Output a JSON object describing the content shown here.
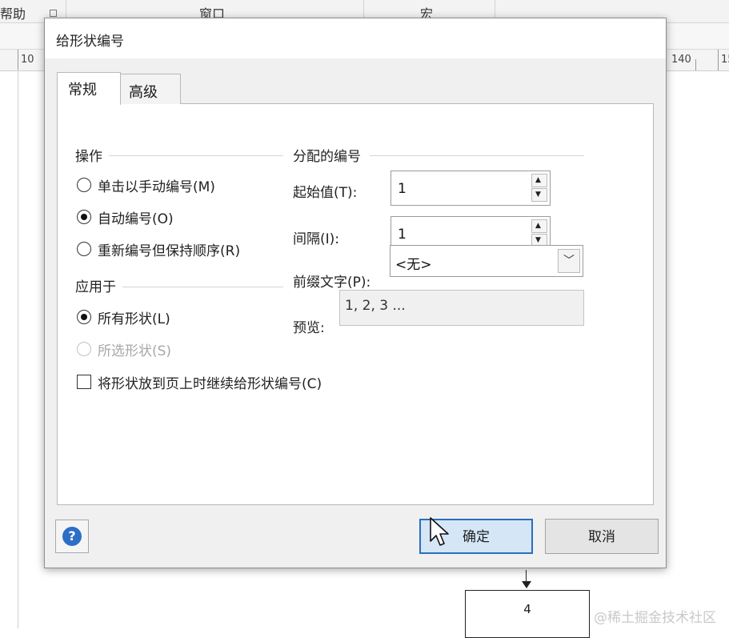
{
  "app": {
    "menubar": {
      "help": "帮助",
      "window": "窗口",
      "macro": "宏"
    },
    "ruler_labels": [
      "10",
      "140",
      "15"
    ],
    "canvas_shape_label": "4",
    "watermark": "@稀土掘金技术社区"
  },
  "dialog": {
    "title": "给形状编号",
    "tabs": [
      {
        "label": "常规",
        "active": true
      },
      {
        "label": "高级",
        "active": false
      }
    ],
    "operation": {
      "title": "操作",
      "options": [
        {
          "label": "单击以手动编号(M)",
          "selected": false
        },
        {
          "label": "自动编号(O)",
          "selected": true
        },
        {
          "label": "重新编号但保持顺序(R)",
          "selected": false
        }
      ]
    },
    "apply_to": {
      "title": "应用于",
      "options": [
        {
          "label": "所有形状(L)",
          "selected": true,
          "enabled": true
        },
        {
          "label": "所选形状(S)",
          "selected": false,
          "enabled": false
        }
      ]
    },
    "continue_checkbox": {
      "label": "将形状放到页上时继续给形状编号(C)",
      "checked": false
    },
    "assigned": {
      "title": "分配的编号",
      "start_label": "起始值(T):",
      "start_value": "1",
      "interval_label": "间隔(I):",
      "interval_value": "1",
      "prefix_label": "前缀文字(P):",
      "prefix_value": "<无>",
      "preview_label": "预览:",
      "preview_value": "1, 2, 3 ..."
    },
    "buttons": {
      "ok": "确定",
      "cancel": "取消",
      "help_icon": "question-mark-icon"
    }
  },
  "colors": {
    "ok_button_border": "#2a6ebc",
    "ok_button_fill": "#d5e6f7",
    "help_icon": "#2d6fc7"
  }
}
